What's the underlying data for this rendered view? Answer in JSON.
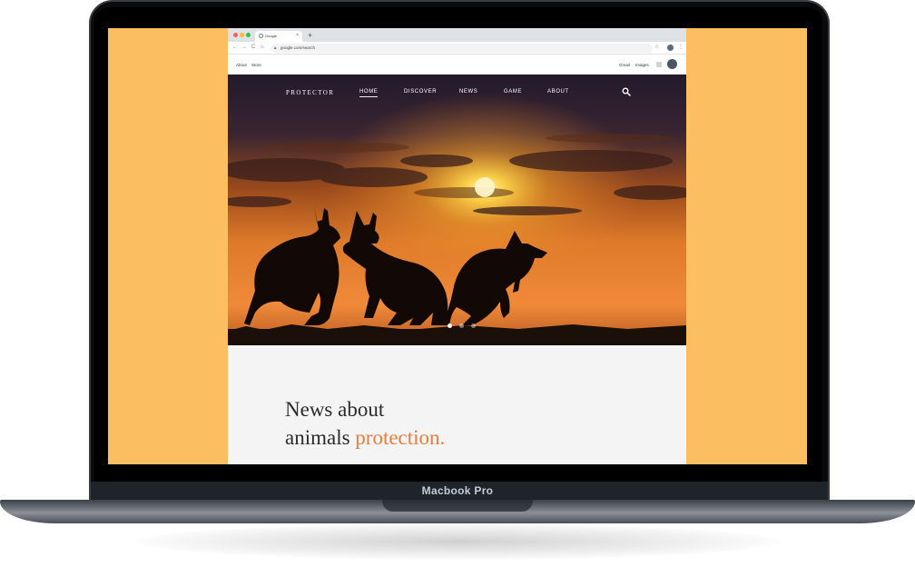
{
  "device": {
    "label": "Macbook Pro"
  },
  "browser": {
    "tab_title": "Google",
    "tab_close": "×",
    "new_tab": "+",
    "url": "google.com/search",
    "nav_back": "←",
    "nav_forward": "→",
    "nav_reload": "C",
    "nav_home": "⌂",
    "star": "☆",
    "menu": "⋮"
  },
  "google_bar": {
    "left_links": [
      "About",
      "Store"
    ],
    "right_links": [
      "Gmail",
      "Images"
    ]
  },
  "site": {
    "brand": "PROTECTOR",
    "nav": [
      "HOME",
      "DISCOVER",
      "NEWS",
      "GAME",
      "ABOUT"
    ],
    "active_nav": "HOME",
    "carousel": {
      "count": 3,
      "active_index": 0
    },
    "headline_line1": "News about",
    "headline_line2_prefix": "animals ",
    "headline_accent": "protection."
  },
  "colors": {
    "backdrop": "#fbbf62",
    "accent": "#e67d3c"
  },
  "icons": [
    "search-icon",
    "lock-icon",
    "star-icon",
    "apps-icon",
    "google-icon"
  ]
}
